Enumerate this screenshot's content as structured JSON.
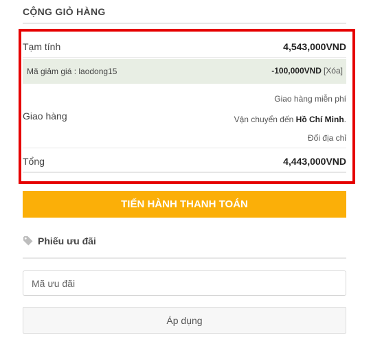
{
  "cart_totals": {
    "title": "CỘNG GIỎ HÀNG",
    "subtotal": {
      "label": "Tạm tính",
      "value": "4,543,000VND"
    },
    "coupon_line": {
      "label": "Mã giảm giá : laodong15",
      "amount": "-100,000VND",
      "remove_label": "[Xóa]"
    },
    "shipping": {
      "label": "Giao hàng",
      "method": "Giao hàng miễn phí",
      "destination_prefix": "Vận chuyển đến ",
      "destination_city": "Hồ Chí Minh",
      "destination_suffix": ".",
      "change_address": "Đổi địa chỉ"
    },
    "total": {
      "label": "Tổng",
      "value": "4,443,000VND"
    },
    "checkout_button": "TIẾN HÀNH THANH TOÁN"
  },
  "coupon_form": {
    "heading": "Phiếu ưu đãi",
    "heading_icon": "tag-icon",
    "input_placeholder": "Mã ưu đãi",
    "input_value": "",
    "apply_button": "Áp dụng"
  },
  "colors": {
    "highlight_frame": "#e60000",
    "checkout_button": "#fbaf08",
    "coupon_row_bg": "#e8eee4"
  }
}
